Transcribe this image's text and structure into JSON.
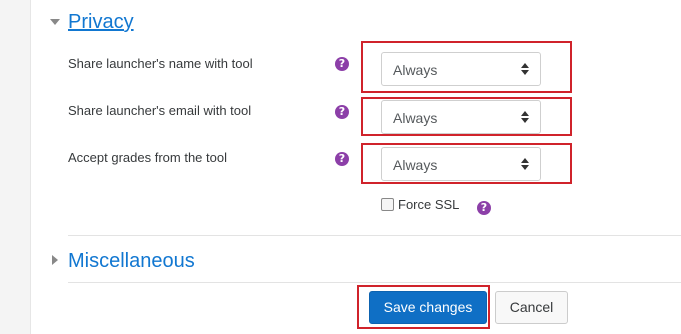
{
  "privacy": {
    "title": "Privacy",
    "rows": [
      {
        "label": "Share launcher's name with tool",
        "value": "Always"
      },
      {
        "label": "Share launcher's email with tool",
        "value": "Always"
      },
      {
        "label": "Accept grades from the tool",
        "value": "Always"
      }
    ],
    "help_glyph": "?",
    "force_ssl": {
      "label": "Force SSL",
      "checked": false
    }
  },
  "misc": {
    "title": "Miscellaneous"
  },
  "buttons": {
    "save": "Save changes",
    "cancel": "Cancel"
  },
  "colors": {
    "link_blue": "#1177d1",
    "primary_button": "#0f6fc5",
    "help_icon": "#8c3fa8",
    "highlight_red": "#d0232b"
  },
  "icons": [
    "collapse-toggle-icon",
    "expand-toggle-icon",
    "help-icon",
    "select-arrows-icon",
    "checkbox-icon"
  ]
}
